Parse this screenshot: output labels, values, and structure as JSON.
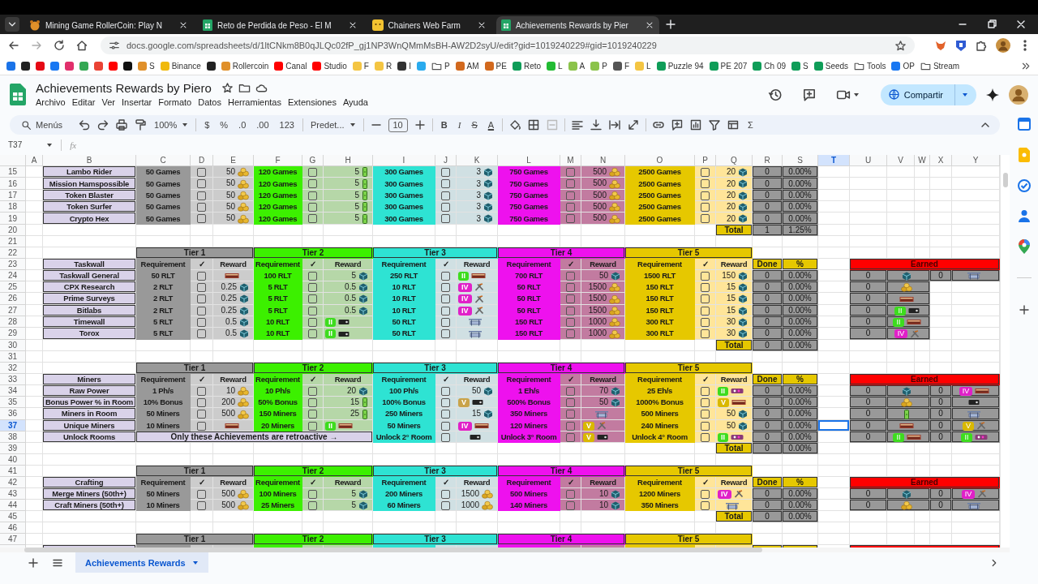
{
  "browser": {
    "tabs": [
      {
        "title": "Mining Game RollerCoin: Play N",
        "kind": "hamster",
        "selected": false
      },
      {
        "title": "Reto de Perdida de Peso - El M",
        "kind": "sheets",
        "selected": false
      },
      {
        "title": "Chainers Web Farm",
        "kind": "face",
        "selected": false
      },
      {
        "title": "Achievements Rewards by Pier",
        "kind": "sheets",
        "selected": true
      }
    ],
    "url": "docs.google.com/spreadsheets/d/1ltCNkm8B0qJLQc02fP_gj1NP3WnQMmMsBH-AW2D2syU/edit?gid=1019240229#gid=1019240229",
    "bookmarks": [
      {
        "kind": "site",
        "color": "#1a73e8"
      },
      {
        "kind": "site",
        "color": "#222222"
      },
      {
        "kind": "site",
        "color": "#e50914"
      },
      {
        "kind": "site",
        "color": "#1877f2"
      },
      {
        "kind": "site",
        "color": "#e1306c"
      },
      {
        "kind": "site",
        "color": "#34a853"
      },
      {
        "kind": "site",
        "color": "#ea4335"
      },
      {
        "kind": "site",
        "color": "#ff0000"
      },
      {
        "kind": "site",
        "color": "#111111"
      },
      {
        "label": "S",
        "kind": "site",
        "color": "#e0902a"
      },
      {
        "label": "Binance",
        "kind": "site",
        "color": "#f0b90b"
      },
      {
        "kind": "site",
        "color": "#222222"
      },
      {
        "label": "Rollercoin",
        "kind": "site",
        "color": "#e0902a"
      },
      {
        "label": "Canal",
        "kind": "site",
        "color": "#ff0000"
      },
      {
        "label": "Studio",
        "kind": "site",
        "color": "#ff0000"
      },
      {
        "label": "F",
        "kind": "site",
        "color": "#f4c542"
      },
      {
        "label": "R",
        "kind": "site",
        "color": "#f4c542"
      },
      {
        "label": "I",
        "kind": "site",
        "color": "#333333"
      },
      {
        "kind": "site",
        "color": "#2aabee"
      },
      {
        "label": "P",
        "kind": "folder"
      },
      {
        "label": "AM",
        "kind": "site",
        "color": "#d2691e"
      },
      {
        "label": "PE",
        "kind": "site",
        "color": "#d2691e"
      },
      {
        "label": "Reto",
        "kind": "site",
        "color": "#0f9d58"
      },
      {
        "label": "L",
        "kind": "site",
        "color": "#22bb33"
      },
      {
        "label": "A",
        "kind": "site",
        "color": "#8bc34a"
      },
      {
        "label": "P",
        "kind": "site",
        "color": "#8bc34a"
      },
      {
        "label": "F",
        "kind": "site",
        "color": "#555555"
      },
      {
        "label": "L",
        "kind": "site",
        "color": "#f4c542"
      },
      {
        "label": "Puzzle 94",
        "kind": "site",
        "color": "#0f9d58"
      },
      {
        "label": "PE 207",
        "kind": "site",
        "color": "#0f9d58"
      },
      {
        "label": "Ch 09",
        "kind": "site",
        "color": "#0f9d58"
      },
      {
        "label": "S",
        "kind": "site",
        "color": "#0f9d58"
      },
      {
        "label": "Seeds",
        "kind": "site",
        "color": "#0f9d58"
      },
      {
        "label": "Tools",
        "kind": "folder"
      },
      {
        "label": "OP",
        "kind": "site",
        "color": "#1877f2"
      },
      {
        "label": "Stream",
        "kind": "folder"
      }
    ]
  },
  "document": {
    "title": "Achievements Rewards by Piero",
    "menus": [
      "Archivo",
      "Editar",
      "Ver",
      "Insertar",
      "Formato",
      "Datos",
      "Herramientas",
      "Extensiones",
      "Ayuda"
    ],
    "share": "Compartir"
  },
  "toolbar": [
    {
      "kind": "search",
      "label": "Menús"
    },
    {
      "kind": "undo"
    },
    {
      "kind": "redo"
    },
    {
      "kind": "printer"
    },
    {
      "kind": "paint-roller"
    },
    {
      "kind": "dropdown",
      "label": "100%"
    },
    {
      "kind": "separator"
    },
    {
      "kind": "text",
      "label": "$"
    },
    {
      "kind": "text",
      "label": "%"
    },
    {
      "kind": "text",
      "label": ".0"
    },
    {
      "kind": "text",
      "label": ".00"
    },
    {
      "kind": "text",
      "label": "123"
    },
    {
      "kind": "separator"
    },
    {
      "kind": "dropdown",
      "label": "Predet..."
    },
    {
      "kind": "separator"
    },
    {
      "kind": "minus"
    },
    {
      "kind": "field",
      "value": "10"
    },
    {
      "kind": "plus"
    },
    {
      "kind": "separator"
    },
    {
      "kind": "bold",
      "label": "B"
    },
    {
      "kind": "italic",
      "label": "I"
    },
    {
      "kind": "strike",
      "label": "S"
    },
    {
      "kind": "underline",
      "label": "A"
    },
    {
      "kind": "separator"
    },
    {
      "kind": "paint-bucket"
    },
    {
      "kind": "borders"
    },
    {
      "kind": "merge"
    },
    {
      "kind": "separator"
    },
    {
      "kind": "align-left"
    },
    {
      "kind": "align-bottom"
    },
    {
      "kind": "text-wrap"
    },
    {
      "kind": "rotate"
    },
    {
      "kind": "separator"
    },
    {
      "kind": "link"
    },
    {
      "kind": "comment"
    },
    {
      "kind": "chart"
    },
    {
      "kind": "filter"
    },
    {
      "kind": "table"
    },
    {
      "kind": "text",
      "label": "Σ"
    }
  ],
  "formula_bar": {
    "name_box": "T37",
    "fx": "fx"
  },
  "sheet": {
    "columns": [
      {
        "label": "A",
        "selected": false
      },
      {
        "label": "B",
        "selected": false
      },
      {
        "label": "C",
        "selected": false
      },
      {
        "label": "D",
        "selected": false
      },
      {
        "label": "E",
        "selected": false
      },
      {
        "label": "F",
        "selected": false
      },
      {
        "label": "G",
        "selected": false
      },
      {
        "label": "H",
        "selected": false
      },
      {
        "label": "I",
        "selected": false
      },
      {
        "label": "J",
        "selected": false
      },
      {
        "label": "K",
        "selected": false
      },
      {
        "label": "L",
        "selected": false
      },
      {
        "label": "M",
        "selected": false
      },
      {
        "label": "N",
        "selected": false
      },
      {
        "label": "O",
        "selected": false
      },
      {
        "label": "P",
        "selected": false
      },
      {
        "label": "Q",
        "selected": false
      },
      {
        "label": "R",
        "selected": false
      },
      {
        "label": "S",
        "selected": false
      },
      {
        "label": "T",
        "selected": true
      },
      {
        "label": "U",
        "selected": false
      },
      {
        "label": "V",
        "selected": false
      },
      {
        "label": "W",
        "selected": false
      },
      {
        "label": "X",
        "selected": false
      },
      {
        "label": "Y",
        "selected": false
      }
    ],
    "rows": [
      {
        "label": "15",
        "selected": false
      },
      {
        "label": "16",
        "selected": false
      },
      {
        "label": "17",
        "selected": false
      },
      {
        "label": "18",
        "selected": false
      },
      {
        "label": "19",
        "selected": false
      },
      {
        "label": "20",
        "selected": false
      },
      {
        "label": "21",
        "selected": false
      },
      {
        "label": "22",
        "selected": false
      },
      {
        "label": "23",
        "selected": false
      },
      {
        "label": "24",
        "selected": false
      },
      {
        "label": "25",
        "selected": false
      },
      {
        "label": "26",
        "selected": false
      },
      {
        "label": "27",
        "selected": false
      },
      {
        "label": "28",
        "selected": false
      },
      {
        "label": "29",
        "selected": false
      },
      {
        "label": "30",
        "selected": false
      },
      {
        "label": "31",
        "selected": false
      },
      {
        "label": "32",
        "selected": false
      },
      {
        "label": "33",
        "selected": false
      },
      {
        "label": "34",
        "selected": false
      },
      {
        "label": "35",
        "selected": false
      },
      {
        "label": "36",
        "selected": false
      },
      {
        "label": "37",
        "selected": true
      },
      {
        "label": "38",
        "selected": false
      },
      {
        "label": "39",
        "selected": false
      },
      {
        "label": "40",
        "selected": false
      },
      {
        "label": "41",
        "selected": false
      },
      {
        "label": "42",
        "selected": false
      },
      {
        "label": "43",
        "selected": false
      },
      {
        "label": "44",
        "selected": false
      },
      {
        "label": "45",
        "selected": false
      },
      {
        "label": "46",
        "selected": false
      },
      {
        "label": "47",
        "selected": false
      }
    ],
    "tiers": [
      {
        "color": "#999999"
      },
      {
        "color": "#3cf000"
      },
      {
        "color": "#2ee3d3"
      },
      {
        "color": "#ee11ee"
      },
      {
        "color": "#e6c800"
      }
    ],
    "sections": [
      {
        "rows": [
          {
            "name": "Lambo Rider",
            "tiers": [
              {
                "requirement": "50 Games",
                "checked": false,
                "reward": {
                  "amount": "50",
                  "kind": "coin"
                }
              },
              {
                "requirement": "120 Games",
                "checked": false,
                "reward": {
                  "amount": "5",
                  "kind": "battery"
                }
              },
              {
                "requirement": "300 Games",
                "checked": false,
                "reward": {
                  "amount": "3",
                  "kind": "cube"
                }
              },
              {
                "requirement": "750 Games",
                "checked": false,
                "reward": {
                  "amount": "500",
                  "kind": "coin"
                }
              },
              {
                "requirement": "2500 Games",
                "checked": false,
                "reward": {
                  "amount": "20",
                  "kind": "cube"
                }
              }
            ],
            "done": "0",
            "percent": "0.00%"
          },
          {
            "name": "Mission Hamspossible",
            "tiers": [
              {
                "requirement": "50 Games",
                "checked": false,
                "reward": {
                  "amount": "50",
                  "kind": "coin"
                }
              },
              {
                "requirement": "120 Games",
                "checked": false,
                "reward": {
                  "amount": "5",
                  "kind": "battery"
                }
              },
              {
                "requirement": "300 Games",
                "checked": false,
                "reward": {
                  "amount": "3",
                  "kind": "cube"
                }
              },
              {
                "requirement": "750 Games",
                "checked": false,
                "reward": {
                  "amount": "500",
                  "kind": "coin"
                }
              },
              {
                "requirement": "2500 Games",
                "checked": false,
                "reward": {
                  "amount": "20",
                  "kind": "cube"
                }
              }
            ],
            "done": "0",
            "percent": "0.00%"
          },
          {
            "name": "Token Blaster",
            "tiers": [
              {
                "requirement": "50 Games",
                "checked": false,
                "reward": {
                  "amount": "50",
                  "kind": "coin"
                }
              },
              {
                "requirement": "120 Games",
                "checked": false,
                "reward": {
                  "amount": "5",
                  "kind": "battery"
                }
              },
              {
                "requirement": "300 Games",
                "checked": false,
                "reward": {
                  "amount": "3",
                  "kind": "cube"
                }
              },
              {
                "requirement": "750 Games",
                "checked": false,
                "reward": {
                  "amount": "500",
                  "kind": "coin"
                }
              },
              {
                "requirement": "2500 Games",
                "checked": false,
                "reward": {
                  "amount": "20",
                  "kind": "cube"
                }
              }
            ],
            "done": "0",
            "percent": "0.00%"
          },
          {
            "name": "Token Surfer",
            "tiers": [
              {
                "requirement": "50 Games",
                "checked": false,
                "reward": {
                  "amount": "50",
                  "kind": "coin"
                }
              },
              {
                "requirement": "120 Games",
                "checked": false,
                "reward": {
                  "amount": "5",
                  "kind": "battery"
                }
              },
              {
                "requirement": "300 Games",
                "checked": false,
                "reward": {
                  "amount": "3",
                  "kind": "cube"
                }
              },
              {
                "requirement": "750 Games",
                "checked": false,
                "reward": {
                  "amount": "500",
                  "kind": "coin"
                }
              },
              {
                "requirement": "2500 Games",
                "checked": false,
                "reward": {
                  "amount": "20",
                  "kind": "cube"
                }
              }
            ],
            "done": "0",
            "percent": "0.00%"
          },
          {
            "name": "Crypto Hex",
            "tiers": [
              {
                "requirement": "50 Games",
                "checked": false,
                "reward": {
                  "amount": "50",
                  "kind": "coin"
                }
              },
              {
                "requirement": "120 Games",
                "checked": false,
                "reward": {
                  "amount": "5",
                  "kind": "battery"
                }
              },
              {
                "requirement": "300 Games",
                "checked": false,
                "reward": {
                  "amount": "3",
                  "kind": "cube"
                }
              },
              {
                "requirement": "750 Games",
                "checked": false,
                "reward": {
                  "amount": "500",
                  "kind": "coin"
                }
              },
              {
                "requirement": "2500 Games",
                "checked": false,
                "reward": {
                  "amount": "20",
                  "kind": "cube"
                }
              }
            ],
            "done": "0",
            "percent": "0.00%"
          }
        ],
        "total": {
          "label": "Total",
          "done": "1",
          "percent": "1.25%"
        }
      },
      {
        "tier_labels": [
          "Tier 1",
          "Tier 2",
          "Tier 3",
          "Tier 4",
          "Tier 5"
        ],
        "headings": {
          "title": "Taskwall",
          "tiers": [
            {
              "requirement": "Requirement",
              "check": "✓",
              "reward": "Reward"
            },
            {
              "requirement": "Requirement",
              "check": "✓",
              "reward": "Reward"
            },
            {
              "requirement": "Requirement",
              "check": "✓",
              "reward": "Reward"
            },
            {
              "requirement": "Requirement",
              "check": "✓",
              "reward": "Reward"
            },
            {
              "requirement": "Requirement",
              "check": "✓",
              "reward": "Reward"
            }
          ],
          "done": "Done",
          "percent": "%"
        },
        "rows": [
          {
            "name": "Taskwall General",
            "tiers": [
              {
                "requirement": "50 RLT",
                "checked": false,
                "reward": {
                  "kind": "rack"
                }
              },
              {
                "requirement": "100 RLT",
                "checked": false,
                "reward": {
                  "amount": "5",
                  "kind": "cube"
                }
              },
              {
                "requirement": "250 RLT",
                "checked": false,
                "reward": {
                  "badge": "II",
                  "color": "#3ddc1e",
                  "kind": "rack"
                }
              },
              {
                "requirement": "700 RLT",
                "checked": false,
                "reward": {
                  "amount": "50",
                  "kind": "cube"
                }
              },
              {
                "requirement": "1500 RLT",
                "checked": false,
                "reward": {
                  "amount": "150",
                  "kind": "cube"
                }
              }
            ],
            "done": "0",
            "percent": "0.00%"
          },
          {
            "name": "CPX Research",
            "tiers": [
              {
                "requirement": "2 RLT",
                "checked": false,
                "reward": {
                  "amount": "0.25",
                  "kind": "cube"
                }
              },
              {
                "requirement": "5 RLT",
                "checked": false,
                "reward": {
                  "amount": "0.5",
                  "kind": "cube"
                }
              },
              {
                "requirement": "10 RLT",
                "checked": false,
                "reward": {
                  "badge": "IV",
                  "color": "#e020c8",
                  "kind": "tool"
                }
              },
              {
                "requirement": "50 RLT",
                "checked": false,
                "reward": {
                  "amount": "1500",
                  "kind": "coin"
                }
              },
              {
                "requirement": "150 RLT",
                "checked": false,
                "reward": {
                  "amount": "15",
                  "kind": "cube"
                }
              }
            ],
            "done": "0",
            "percent": "0.00%"
          },
          {
            "name": "Prime Surveys",
            "tiers": [
              {
                "requirement": "2 RLT",
                "checked": false,
                "reward": {
                  "amount": "0.25",
                  "kind": "cube"
                }
              },
              {
                "requirement": "5 RLT",
                "checked": false,
                "reward": {
                  "amount": "0.5",
                  "kind": "cube"
                }
              },
              {
                "requirement": "10 RLT",
                "checked": false,
                "reward": {
                  "badge": "IV",
                  "color": "#e020c8",
                  "kind": "tool"
                }
              },
              {
                "requirement": "50 RLT",
                "checked": false,
                "reward": {
                  "amount": "1500",
                  "kind": "coin"
                }
              },
              {
                "requirement": "150 RLT",
                "checked": false,
                "reward": {
                  "amount": "15",
                  "kind": "cube"
                }
              }
            ],
            "done": "0",
            "percent": "0.00%"
          },
          {
            "name": "Bitlabs",
            "tiers": [
              {
                "requirement": "2 RLT",
                "checked": false,
                "reward": {
                  "amount": "0.25",
                  "kind": "cube"
                }
              },
              {
                "requirement": "5 RLT",
                "checked": false,
                "reward": {
                  "amount": "0.5",
                  "kind": "cube"
                }
              },
              {
                "requirement": "10 RLT",
                "checked": false,
                "reward": {
                  "badge": "IV",
                  "color": "#e020c8",
                  "kind": "tool"
                }
              },
              {
                "requirement": "50 RLT",
                "checked": false,
                "reward": {
                  "amount": "1500",
                  "kind": "coin"
                }
              },
              {
                "requirement": "150 RLT",
                "checked": false,
                "reward": {
                  "amount": "15",
                  "kind": "cube"
                }
              }
            ],
            "done": "0",
            "percent": "0.00%"
          },
          {
            "name": "Timewall",
            "tiers": [
              {
                "requirement": "5 RLT",
                "checked": false,
                "reward": {
                  "amount": "0.5",
                  "kind": "cube"
                }
              },
              {
                "requirement": "10 RLT",
                "checked": false,
                "reward": {
                  "badge": "II",
                  "color": "#3ddc1e",
                  "kind": "device"
                }
              },
              {
                "requirement": "50 RLT",
                "checked": false,
                "reward": {
                  "kind": "cart"
                }
              },
              {
                "requirement": "150 RLT",
                "checked": false,
                "reward": {
                  "amount": "1000",
                  "kind": "coin"
                }
              },
              {
                "requirement": "300 RLT",
                "checked": false,
                "reward": {
                  "amount": "30",
                  "kind": "cube"
                }
              }
            ],
            "done": "0",
            "percent": "0.00%"
          },
          {
            "name": "Torox",
            "tiers": [
              {
                "requirement": "5 RLT",
                "checked": false,
                "reward": {
                  "amount": "0.5",
                  "kind": "cube"
                }
              },
              {
                "requirement": "10 RLT",
                "checked": false,
                "reward": {
                  "badge": "II",
                  "color": "#3ddc1e",
                  "kind": "device"
                }
              },
              {
                "requirement": "50 RLT",
                "checked": false,
                "reward": {
                  "kind": "cart"
                }
              },
              {
                "requirement": "150 RLT",
                "checked": false,
                "reward": {
                  "amount": "1000",
                  "kind": "coin"
                }
              },
              {
                "requirement": "300 RLT",
                "checked": false,
                "reward": {
                  "amount": "30",
                  "kind": "cube"
                }
              }
            ],
            "done": "0",
            "percent": "0.00%"
          }
        ],
        "total": {
          "label": "Total",
          "done": "0",
          "percent": "0.00%"
        },
        "earned": {
          "title": "Earned",
          "rows": [
            {
              "count": "0",
              "reward": {
                "kind": "cube"
              },
              "count_2": "0",
              "reward_2": {
                "kind": "cart"
              }
            },
            {
              "count": "0",
              "reward": {
                "kind": "coin"
              }
            },
            {
              "count": "0",
              "reward": {
                "kind": "rack"
              }
            },
            {
              "count": "0",
              "reward": {
                "badge": "II",
                "color": "#3ddc1e",
                "kind": "device"
              }
            },
            {
              "count": "0",
              "reward": {
                "badge": "II",
                "color": "#3ddc1e",
                "kind": "rack"
              }
            },
            {
              "count": "0",
              "reward": {
                "badge": "IV",
                "color": "#e020c8",
                "kind": "tool"
              }
            }
          ]
        }
      },
      {
        "tier_labels": [
          "Tier 1",
          "Tier 2",
          "Tier 3",
          "Tier 4",
          "Tier 5"
        ],
        "headings": {
          "title": "Miners",
          "tiers": [
            {
              "requirement": "Requirement",
              "check": "✓",
              "reward": "Reward"
            },
            {
              "requirement": "Requirement",
              "check": "✓",
              "reward": "Reward"
            },
            {
              "requirement": "Requirement",
              "check": "✓",
              "reward": "Reward"
            },
            {
              "requirement": "Requirement",
              "check": "✓",
              "reward": "Reward"
            },
            {
              "requirement": "Requirement",
              "check": "✓",
              "reward": "Reward"
            }
          ],
          "done": "Done",
          "percent": "%"
        },
        "rows": [
          {
            "name": "Raw Power",
            "tiers": [
              {
                "requirement": "1 Ph/s",
                "checked": false,
                "reward": {
                  "amount": "10",
                  "kind": "coin"
                }
              },
              {
                "requirement": "10 Ph/s",
                "checked": false,
                "reward": {
                  "amount": "20",
                  "kind": "cube"
                }
              },
              {
                "requirement": "100 Ph/s",
                "checked": false,
                "reward": {
                  "amount": "50",
                  "kind": "cube"
                }
              },
              {
                "requirement": "1 Eh/s",
                "checked": false,
                "reward": {
                  "amount": "70",
                  "kind": "cube"
                }
              },
              {
                "requirement": "25 Eh/s",
                "checked": false,
                "reward": {
                  "badge": "II",
                  "color": "#3ddc1e",
                  "kind": "miner"
                }
              }
            ],
            "done": "0",
            "percent": "0.00%"
          },
          {
            "name": "Bonus Power % in Room",
            "tiers": [
              {
                "requirement": "10% Bonus",
                "checked": false,
                "reward": {
                  "amount": "200",
                  "kind": "coin"
                }
              },
              {
                "requirement": "50% Bonus",
                "checked": false,
                "reward": {
                  "amount": "15",
                  "kind": "battery"
                }
              },
              {
                "requirement": "100% Bonus",
                "checked": false,
                "reward": {
                  "badge": "V",
                  "color": "#c9a34a",
                  "kind": "device"
                }
              },
              {
                "requirement": "500% Bonus",
                "checked": false,
                "reward": {
                  "amount": "50",
                  "kind": "cube"
                }
              },
              {
                "requirement": "1000% Bonus",
                "checked": false,
                "reward": {
                  "badge": "V",
                  "color": "#d9b800",
                  "kind": "rack"
                }
              }
            ],
            "done": "0",
            "percent": "0.00%"
          },
          {
            "name": "Miners in Room",
            "tiers": [
              {
                "requirement": "50 Miners",
                "checked": false,
                "reward": {
                  "amount": "500",
                  "kind": "coin"
                }
              },
              {
                "requirement": "150 Miners",
                "checked": false,
                "reward": {
                  "amount": "25",
                  "kind": "battery"
                }
              },
              {
                "requirement": "250 Miners",
                "checked": false,
                "reward": {
                  "amount": "15",
                  "kind": "cube"
                }
              },
              {
                "requirement": "350 Miners",
                "checked": false,
                "reward": {
                  "kind": "cart"
                }
              },
              {
                "requirement": "500 Miners",
                "checked": false,
                "reward": {
                  "amount": "50",
                  "kind": "cube"
                }
              }
            ],
            "done": "0",
            "percent": "0.00%"
          },
          {
            "name": "Unique Miners",
            "tiers": [
              {
                "requirement": "10 Miners",
                "checked": false,
                "reward": {
                  "kind": "rack"
                }
              },
              {
                "requirement": "20 Miners",
                "checked": false,
                "reward": {
                  "badge": "II",
                  "color": "#3ddc1e",
                  "kind": "rack"
                }
              },
              {
                "requirement": "50 Miners",
                "checked": false,
                "reward": {
                  "badge": "IV",
                  "color": "#e020c8",
                  "kind": "rack"
                }
              },
              {
                "requirement": "120 Miners",
                "checked": false,
                "reward": {
                  "badge": "V",
                  "color": "#d9b800",
                  "kind": "tool"
                }
              },
              {
                "requirement": "240 Miners",
                "checked": false,
                "reward": {
                  "amount": "50",
                  "kind": "cube"
                }
              }
            ],
            "done": "0",
            "percent": "0.00%"
          },
          {
            "name": "Unlock Rooms",
            "tiers": [
              {
                "kind": "note",
                "text": "Only these Achievements are retroactive →"
              },
              {
                "kind": "goal",
                "requirement": "Unlock 2° Room",
                "checked": false,
                "reward": {
                  "kind": "device"
                }
              },
              {
                "kind": "goal",
                "requirement": "Unlock 3° Room",
                "checked": false,
                "reward": {
                  "badge": "V",
                  "color": "#d9b800",
                  "kind": "device"
                }
              },
              {
                "kind": "goal",
                "requirement": "Unlock 4° Room",
                "checked": false,
                "reward": {
                  "badge": "II",
                  "color": "#3ddc1e",
                  "kind": "miner"
                }
              }
            ],
            "done": "0",
            "percent": "0.00%"
          }
        ],
        "total": {
          "label": "Total",
          "done": "0",
          "percent": "0.00%"
        },
        "earned": {
          "title": "Earned",
          "rows": [
            {
              "count": "0",
              "reward": {
                "kind": "cube"
              },
              "count_2": "0",
              "reward_2": {
                "badge": "IV",
                "color": "#e020c8",
                "kind": "rack"
              }
            },
            {
              "count": "0",
              "reward": {
                "kind": "coin"
              },
              "count_2": "0",
              "reward_2": {
                "kind": "device"
              }
            },
            {
              "count": "0",
              "reward": {
                "kind": "battery"
              },
              "count_2": "0",
              "reward_2": {
                "kind": "cart"
              }
            },
            {
              "count": "0",
              "reward": {
                "kind": "rack"
              },
              "count_2": "0",
              "reward_2": {
                "badge": "V",
                "color": "#d9b800",
                "kind": "tool"
              }
            },
            {
              "count": "0",
              "reward": {
                "badge": "II",
                "color": "#3ddc1e",
                "kind": "rack"
              },
              "count_2": "0",
              "reward_2": {
                "badge": "II",
                "color": "#3ddc1e",
                "kind": "miner"
              }
            }
          ]
        }
      },
      {
        "tier_labels": [
          "Tier 1",
          "Tier 2",
          "Tier 3",
          "Tier 4",
          "Tier 5"
        ],
        "headings": {
          "title": "Crafting",
          "tiers": [
            {
              "requirement": "Requirement",
              "check": "✓",
              "reward": "Reward"
            },
            {
              "requirement": "Requirement",
              "check": "✓",
              "reward": "Reward"
            },
            {
              "requirement": "Requirement",
              "check": "✓",
              "reward": "Reward"
            },
            {
              "requirement": "Requirement",
              "check": "✓",
              "reward": "Reward"
            },
            {
              "requirement": "Requirement",
              "check": "✓",
              "reward": "Reward"
            }
          ],
          "done": "Done",
          "percent": "%"
        },
        "rows": [
          {
            "name": "Merge Miners (50th+)",
            "tiers": [
              {
                "requirement": "50 Miners",
                "checked": false,
                "reward": {
                  "amount": "500",
                  "kind": "coin"
                }
              },
              {
                "requirement": "100 Miners",
                "checked": false,
                "reward": {
                  "amount": "5",
                  "kind": "cube"
                }
              },
              {
                "requirement": "200 Miners",
                "checked": false,
                "reward": {
                  "amount": "1500",
                  "kind": "coin"
                }
              },
              {
                "requirement": "500 Miners",
                "checked": false,
                "reward": {
                  "amount": "10",
                  "kind": "cube"
                }
              },
              {
                "requirement": "1200 Miners",
                "checked": false,
                "reward": {
                  "badge": "IV",
                  "color": "#e020c8",
                  "kind": "tool"
                }
              }
            ],
            "done": "0",
            "percent": "0.00%"
          },
          {
            "name": "Craft Miners (50th+)",
            "tiers": [
              {
                "requirement": "10 Miners",
                "checked": false,
                "reward": {
                  "amount": "500",
                  "kind": "coin"
                }
              },
              {
                "requirement": "25 Miners",
                "checked": false,
                "reward": {
                  "amount": "5",
                  "kind": "cube"
                }
              },
              {
                "requirement": "60 Miners",
                "checked": false,
                "reward": {
                  "amount": "1000",
                  "kind": "coin"
                }
              },
              {
                "requirement": "140 Miners",
                "checked": false,
                "reward": {
                  "amount": "10",
                  "kind": "cube"
                }
              },
              {
                "requirement": "350 Miners",
                "checked": false,
                "reward": {
                  "kind": "cart"
                }
              }
            ],
            "done": "0",
            "percent": "0.00%"
          }
        ],
        "total": {
          "label": "Total",
          "done": "0",
          "percent": "0.00%"
        },
        "earned": {
          "title": "Earned",
          "rows": [
            {
              "count": "0",
              "reward": {
                "kind": "cube"
              },
              "count_2": "0",
              "reward_2": {
                "badge": "IV",
                "color": "#e020c8",
                "kind": "tool"
              }
            },
            {
              "count": "0",
              "reward": {
                "kind": "coin"
              },
              "count_2": "0",
              "reward_2": {
                "kind": "cart"
              }
            }
          ]
        }
      },
      {
        "tier_labels": [
          "Tier 1",
          "Tier 2",
          "Tier 3",
          "Tier 4",
          "Tier 5"
        ]
      }
    ]
  },
  "sheet_tabs": [
    {
      "label": "Achievements Rewards",
      "selected": true
    }
  ]
}
